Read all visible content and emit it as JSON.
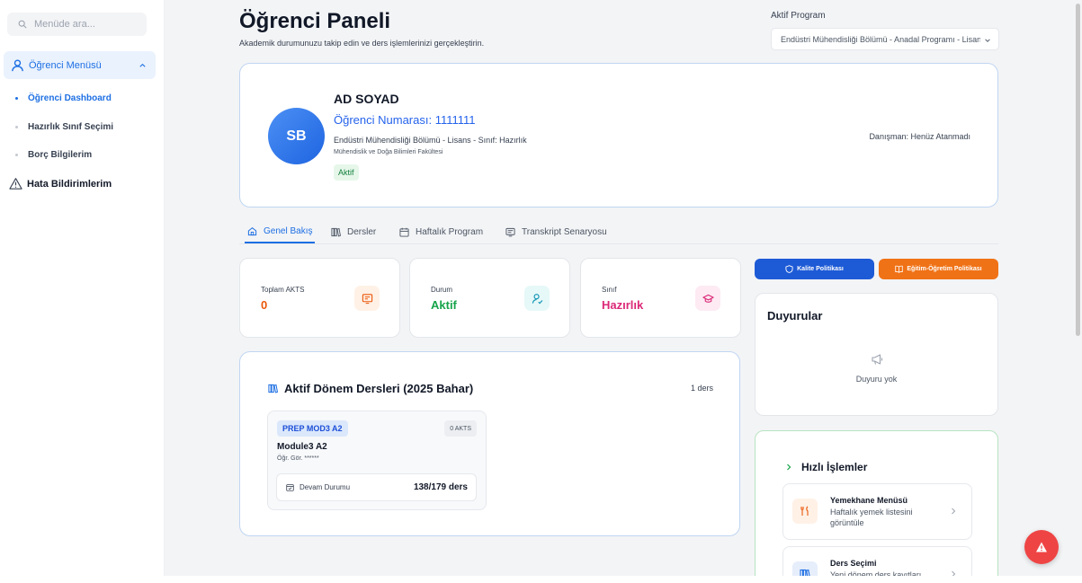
{
  "sidebar": {
    "search_placeholder": "Menüde ara...",
    "group_label": "Öğrenci Menüsü",
    "items": [
      {
        "label": "Öğrenci Dashboard",
        "active": true
      },
      {
        "label": "Hazırlık Sınıf Seçimi",
        "active": false
      },
      {
        "label": "Borç Bilgilerim",
        "active": false
      }
    ],
    "error_report": "Hata Bildirimlerim"
  },
  "header": {
    "title": "Öğrenci Paneli",
    "subtitle": "Akademik durumunuzu takip edin ve ders işlemlerinizi gerçekleştirin.",
    "program_label": "Aktif Program",
    "program_value": "Endüstri Mühendisliği Bölümü - Anadal Programı - Lisans"
  },
  "profile": {
    "initials": "SB",
    "name": "AD SOYAD",
    "student_number": "Öğrenci Numarası: 1111111",
    "department": "Endüstri Mühendisliği Bölümü - Lisans - Sınıf: Hazırlık",
    "faculty": "Mühendislik ve Doğa Bilimleri Fakültesi",
    "status": "Aktif",
    "advisor": "Danışman: Henüz Atanmadı"
  },
  "tabs": [
    {
      "label": "Genel Bakış",
      "active": true
    },
    {
      "label": "Dersler",
      "active": false
    },
    {
      "label": "Haftalık Program",
      "active": false
    },
    {
      "label": "Transkript Senaryosu",
      "active": false
    }
  ],
  "stats": [
    {
      "label": "Toplam AKTS",
      "value": "0",
      "color": "#ea580c"
    },
    {
      "label": "Durum",
      "value": "Aktif",
      "color": "#16a34a"
    },
    {
      "label": "Sınıf",
      "value": "Hazırlık",
      "color": "#db2777"
    }
  ],
  "courses": {
    "title": "Aktif Dönem Dersleri (2025 Bahar)",
    "count": "1 ders",
    "items": [
      {
        "code": "PREP MOD3 A2",
        "akts": "0 AKTS",
        "name": "Module3 A2",
        "teacher": "Öğr. Gör. ******",
        "attendance_label": "Devam Durumu",
        "attendance_value": "138/179 ders"
      }
    ]
  },
  "actions": {
    "quality_policy": "Kalite Politikası",
    "education_policy": "Eğitim-Öğretim Politikası"
  },
  "announcements": {
    "title": "Duyurular",
    "empty": "Duyuru yok"
  },
  "quick": {
    "title": "Hızlı İşlemler",
    "items": [
      {
        "name": "Yemekhane Menüsü",
        "desc": "Haftalık yemek listesini görüntüle"
      },
      {
        "name": "Ders Seçimi",
        "desc": "Yeni dönem ders kayıtları"
      }
    ]
  },
  "colors": {
    "primary": "#1d6fe3",
    "orange": "#f07216",
    "danger": "#ef4444"
  }
}
